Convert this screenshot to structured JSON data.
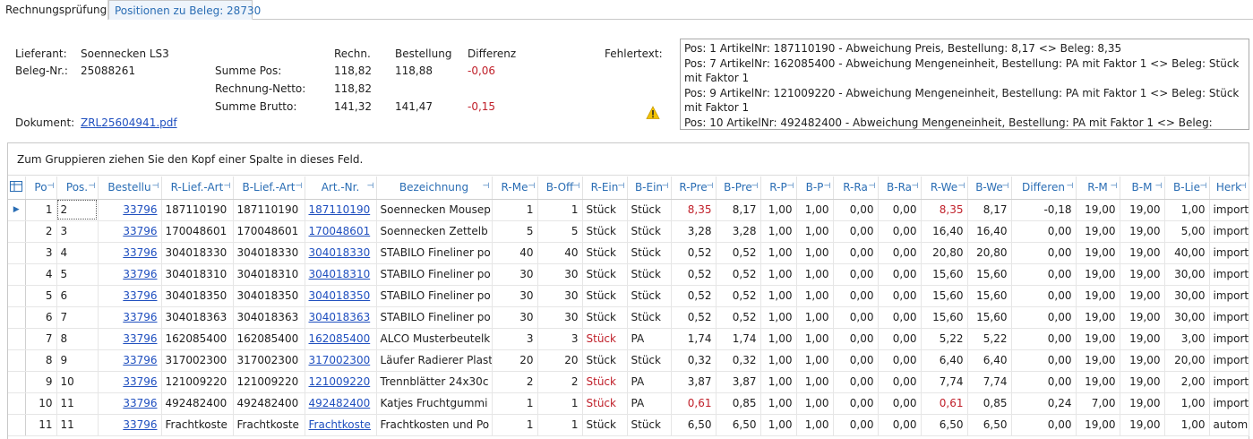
{
  "tabs": [
    {
      "label": "Rechnungsprüfung"
    },
    {
      "label": "Positionen zu Beleg: 28730"
    }
  ],
  "header": {
    "lieferant_label": "Lieferant:",
    "lieferant_value": "Soennecken LS3",
    "beleg_label": "Beleg-Nr.:",
    "beleg_value": "25088261",
    "dokument_label": "Dokument:",
    "dokument_value": "ZRL25604941.pdf",
    "col_rechn": "Rechn.",
    "col_bestellung": "Bestellung",
    "col_differenz": "Differenz",
    "summe_pos_label": "Summe Pos:",
    "summe_pos_rechn": "118,82",
    "summe_pos_bestellung": "118,88",
    "summe_pos_differenz": "-0,06",
    "rechnung_netto_label": "Rechnung-Netto:",
    "rechnung_netto_rechn": "118,82",
    "summe_brutto_label": "Summe Brutto:",
    "summe_brutto_rechn": "141,32",
    "summe_brutto_bestellung": "141,47",
    "summe_brutto_differenz": "-0,15",
    "fehlertext_label": "Fehlertext:",
    "fehlertext_lines": [
      "Pos: 1 ArtikelNr: 187110190 - Abweichung Preis, Bestellung: 8,17 <> Beleg: 8,35",
      "Pos: 7 ArtikelNr: 162085400 - Abweichung Mengeneinheit, Bestellung: PA mit Faktor 1 <> Beleg: Stück mit Faktor 1",
      "Pos: 9 ArtikelNr: 121009220 - Abweichung Mengeneinheit, Bestellung: PA mit Faktor 1 <> Beleg: Stück mit Faktor 1",
      "Pos: 10 ArtikelNr: 492482400 - Abweichung Mengeneinheit, Bestellung: PA mit Faktor 1 <> Beleg: Stück mit"
    ],
    "warning_icon": "warning-icon"
  },
  "grid": {
    "group_panel_text": "Zum Gruppieren ziehen Sie den Kopf einer Spalte in dieses Feld.",
    "columns": [
      "Po",
      "Pos.",
      "Bestellu",
      "R-Lief.-Art",
      "B-Lief.-Art",
      "Art.-Nr.",
      "Bezeichnung",
      "R-Me",
      "B-Off",
      "R-Ein",
      "B-Ein",
      "R-Pre",
      "B-Pre",
      "R-P",
      "B-P",
      "R-Ra",
      "B-Ra",
      "R-We",
      "B-We",
      "Differen",
      "R-M",
      "B-M",
      "B-Lie",
      "Herk"
    ],
    "rows": [
      {
        "po": "1",
        "pos": "2",
        "best": "33796",
        "rlief": "187110190",
        "blief": "187110190",
        "art": "187110190",
        "bez": "Soennecken Mousep",
        "rme": "1",
        "boff": "1",
        "rein": "Stück",
        "bein": "Stück",
        "rpre": "8,35",
        "bpre": "8,17",
        "rp": "1,00",
        "bp": "1,00",
        "rra": "0,00",
        "bra": "0,00",
        "rwe": "8,35",
        "bwe": "8,17",
        "diff": "-0,18",
        "rm": "19,00",
        "bm": "19,00",
        "blie": "1,00",
        "herk": "import"
      },
      {
        "po": "2",
        "pos": "3",
        "best": "33796",
        "rlief": "170048601",
        "blief": "170048601",
        "art": "170048601",
        "bez": "Soennecken Zettelb",
        "rme": "5",
        "boff": "5",
        "rein": "Stück",
        "bein": "Stück",
        "rpre": "3,28",
        "bpre": "3,28",
        "rp": "1,00",
        "bp": "1,00",
        "rra": "0,00",
        "bra": "0,00",
        "rwe": "16,40",
        "bwe": "16,40",
        "diff": "0,00",
        "rm": "19,00",
        "bm": "19,00",
        "blie": "5,00",
        "herk": "import"
      },
      {
        "po": "3",
        "pos": "4",
        "best": "33796",
        "rlief": "304018330",
        "blief": "304018330",
        "art": "304018330",
        "bez": "STABILO Fineliner po",
        "rme": "40",
        "boff": "40",
        "rein": "Stück",
        "bein": "Stück",
        "rpre": "0,52",
        "bpre": "0,52",
        "rp": "1,00",
        "bp": "1,00",
        "rra": "0,00",
        "bra": "0,00",
        "rwe": "20,80",
        "bwe": "20,80",
        "diff": "0,00",
        "rm": "19,00",
        "bm": "19,00",
        "blie": "40,00",
        "herk": "import"
      },
      {
        "po": "4",
        "pos": "5",
        "best": "33796",
        "rlief": "304018310",
        "blief": "304018310",
        "art": "304018310",
        "bez": "STABILO Fineliner po",
        "rme": "30",
        "boff": "30",
        "rein": "Stück",
        "bein": "Stück",
        "rpre": "0,52",
        "bpre": "0,52",
        "rp": "1,00",
        "bp": "1,00",
        "rra": "0,00",
        "bra": "0,00",
        "rwe": "15,60",
        "bwe": "15,60",
        "diff": "0,00",
        "rm": "19,00",
        "bm": "19,00",
        "blie": "30,00",
        "herk": "import"
      },
      {
        "po": "5",
        "pos": "6",
        "best": "33796",
        "rlief": "304018350",
        "blief": "304018350",
        "art": "304018350",
        "bez": "STABILO Fineliner po",
        "rme": "30",
        "boff": "30",
        "rein": "Stück",
        "bein": "Stück",
        "rpre": "0,52",
        "bpre": "0,52",
        "rp": "1,00",
        "bp": "1,00",
        "rra": "0,00",
        "bra": "0,00",
        "rwe": "15,60",
        "bwe": "15,60",
        "diff": "0,00",
        "rm": "19,00",
        "bm": "19,00",
        "blie": "30,00",
        "herk": "import"
      },
      {
        "po": "6",
        "pos": "7",
        "best": "33796",
        "rlief": "304018363",
        "blief": "304018363",
        "art": "304018363",
        "bez": "STABILO Fineliner po",
        "rme": "30",
        "boff": "30",
        "rein": "Stück",
        "bein": "Stück",
        "rpre": "0,52",
        "bpre": "0,52",
        "rp": "1,00",
        "bp": "1,00",
        "rra": "0,00",
        "bra": "0,00",
        "rwe": "15,60",
        "bwe": "15,60",
        "diff": "0,00",
        "rm": "19,00",
        "bm": "19,00",
        "blie": "30,00",
        "herk": "import"
      },
      {
        "po": "7",
        "pos": "8",
        "best": "33796",
        "rlief": "162085400",
        "blief": "162085400",
        "art": "162085400",
        "bez": "ALCO Musterbeutelk",
        "rme": "3",
        "boff": "3",
        "rein": "Stück",
        "bein": "PA",
        "rpre": "1,74",
        "bpre": "1,74",
        "rp": "1,00",
        "bp": "1,00",
        "rra": "0,00",
        "bra": "0,00",
        "rwe": "5,22",
        "bwe": "5,22",
        "diff": "0,00",
        "rm": "19,00",
        "bm": "19,00",
        "blie": "3,00",
        "herk": "import"
      },
      {
        "po": "8",
        "pos": "9",
        "best": "33796",
        "rlief": "317002300",
        "blief": "317002300",
        "art": "317002300",
        "bez": "Läufer Radierer Plast",
        "rme": "20",
        "boff": "20",
        "rein": "Stück",
        "bein": "Stück",
        "rpre": "0,32",
        "bpre": "0,32",
        "rp": "1,00",
        "bp": "1,00",
        "rra": "0,00",
        "bra": "0,00",
        "rwe": "6,40",
        "bwe": "6,40",
        "diff": "0,00",
        "rm": "19,00",
        "bm": "19,00",
        "blie": "20,00",
        "herk": "import"
      },
      {
        "po": "9",
        "pos": "10",
        "best": "33796",
        "rlief": "121009220",
        "blief": "121009220",
        "art": "121009220",
        "bez": "Trennblätter 24x30c",
        "rme": "2",
        "boff": "2",
        "rein": "Stück",
        "bein": "PA",
        "rpre": "3,87",
        "bpre": "3,87",
        "rp": "1,00",
        "bp": "1,00",
        "rra": "0,00",
        "bra": "0,00",
        "rwe": "7,74",
        "bwe": "7,74",
        "diff": "0,00",
        "rm": "19,00",
        "bm": "19,00",
        "blie": "2,00",
        "herk": "import"
      },
      {
        "po": "10",
        "pos": "11",
        "best": "33796",
        "rlief": "492482400",
        "blief": "492482400",
        "art": "492482400",
        "bez": "Katjes Fruchtgummi",
        "rme": "1",
        "boff": "1",
        "rein": "Stück",
        "bein": "PA",
        "rpre": "0,61",
        "bpre": "0,85",
        "rp": "1,00",
        "bp": "1,00",
        "rra": "0,00",
        "bra": "0,00",
        "rwe": "0,61",
        "bwe": "0,85",
        "diff": "0,24",
        "rm": "7,00",
        "bm": "19,00",
        "blie": "1,00",
        "herk": "import"
      },
      {
        "po": "11",
        "pos": "11",
        "best": "33796",
        "rlief": "Frachtkoste",
        "blief": "Frachtkoste",
        "art": "Frachtkoste",
        "bez": "Frachtkosten und Po",
        "rme": "1",
        "boff": "1",
        "rein": "Stück",
        "bein": "Stück",
        "rpre": "6,50",
        "bpre": "6,50",
        "rp": "1,00",
        "bp": "1,00",
        "rra": "0,00",
        "bra": "0,00",
        "rwe": "6,50",
        "bwe": "6,50",
        "diff": "0,00",
        "rm": "19,00",
        "bm": "19,00",
        "blie": "1,00",
        "herk": "autom"
      }
    ],
    "red_cells": [
      {
        "row": 0,
        "key": "rpre"
      },
      {
        "row": 0,
        "key": "rwe"
      },
      {
        "row": 6,
        "key": "rein"
      },
      {
        "row": 8,
        "key": "rein"
      },
      {
        "row": 9,
        "key": "rein"
      },
      {
        "row": 9,
        "key": "rpre"
      },
      {
        "row": 9,
        "key": "rwe"
      }
    ],
    "colors": {
      "accent": "#2a6db4",
      "error": "#c0202a",
      "link": "#1f4fbf"
    }
  }
}
